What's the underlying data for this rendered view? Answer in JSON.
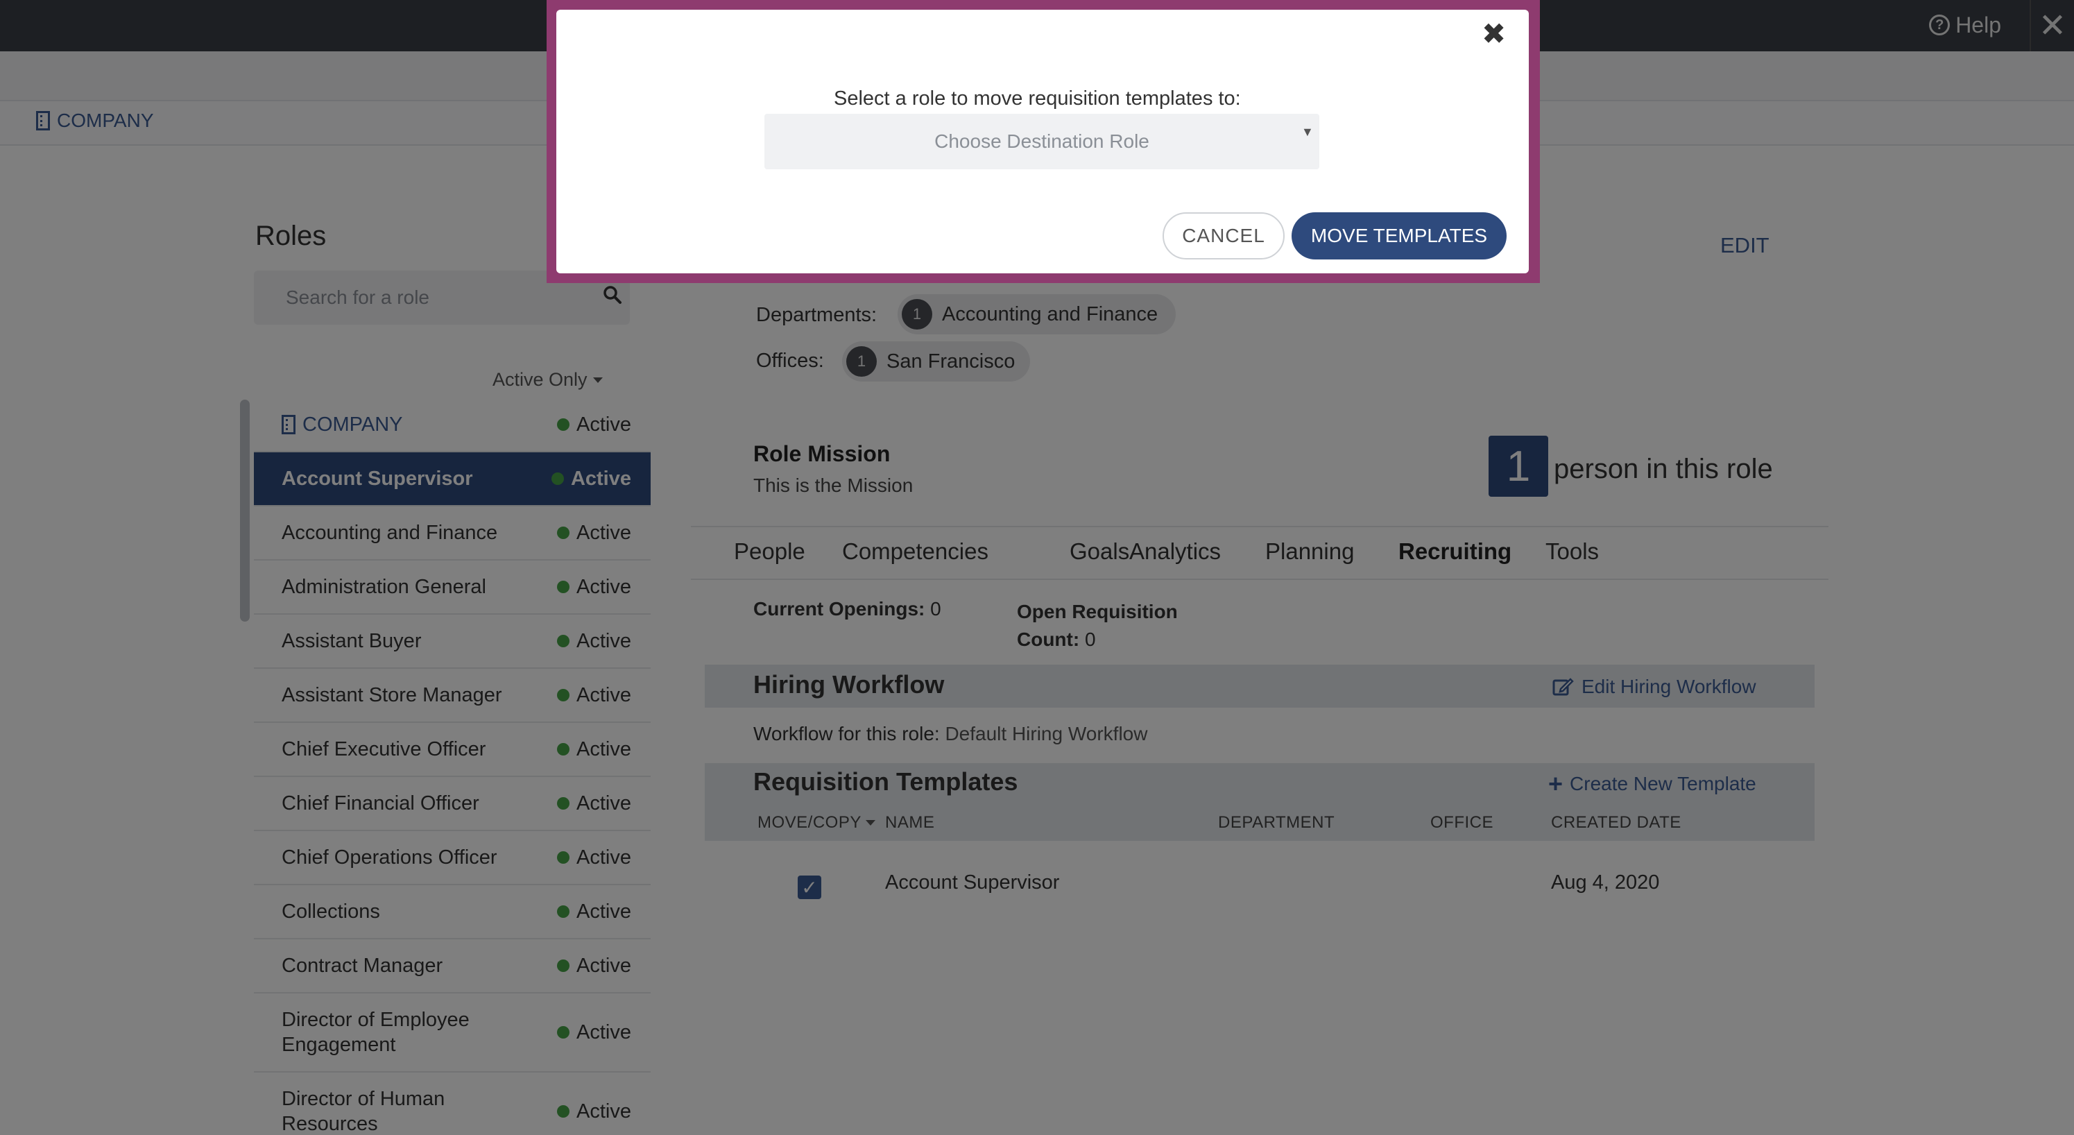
{
  "topbar": {
    "help_label": "Help",
    "help_icon": "question-circle-icon",
    "close_icon": "close-icon"
  },
  "breadcrumb": {
    "label": "COMPANY",
    "icon": "building-icon"
  },
  "roles": {
    "title": "Roles",
    "search_placeholder": "Search for a role",
    "filter_label": "Active Only",
    "items": [
      {
        "name": "COMPANY",
        "status": "Active"
      },
      {
        "name": "Account Supervisor",
        "status": "Active"
      },
      {
        "name": "Accounting and Finance",
        "status": "Active"
      },
      {
        "name": "Administration General",
        "status": "Active"
      },
      {
        "name": "Assistant Buyer",
        "status": "Active"
      },
      {
        "name": "Assistant Store Manager",
        "status": "Active"
      },
      {
        "name": "Chief Executive Officer",
        "status": "Active"
      },
      {
        "name": "Chief Financial Officer",
        "status": "Active"
      },
      {
        "name": "Chief Operations Officer",
        "status": "Active"
      },
      {
        "name": "Collections",
        "status": "Active"
      },
      {
        "name": "Contract Manager",
        "status": "Active"
      },
      {
        "name": "Director of Employee Engagement",
        "status": "Active"
      },
      {
        "name": "Director of Human Resources",
        "status": "Active"
      }
    ]
  },
  "role_detail": {
    "edit_label": "EDIT",
    "departments_label": "Departments:",
    "department_count": "1",
    "department": "Accounting and Finance",
    "offices_label": "Offices:",
    "office_count": "1",
    "office": "San Francisco",
    "mission_title": "Role Mission",
    "mission_text": "This is the Mission",
    "people_count": "1",
    "people_text": "person in this role",
    "tabs": [
      "People",
      "Competencies",
      "Goals",
      "Analytics",
      "Planning",
      "Recruiting",
      "Tools"
    ],
    "active_tab": "Recruiting"
  },
  "recruiting": {
    "openings_label": "Current Openings:",
    "openings_value": "0",
    "openreq_label_1": "Open Requisition",
    "openreq_label_2": "Count:",
    "openreq_value": "0",
    "hiring_workflow_title": "Hiring Workflow",
    "edit_workflow_label": "Edit Hiring Workflow",
    "workflow_label": "Workflow for this role:",
    "workflow_value": "Default Hiring Workflow",
    "templates_title": "Requisition Templates",
    "create_template_label": "Create New Template",
    "columns": [
      "MOVE/COPY",
      "NAME",
      "DEPARTMENT",
      "OFFICE",
      "CREATED DATE"
    ],
    "rows": [
      {
        "checked": true,
        "name": "Account Supervisor",
        "department": "",
        "office": "",
        "created": "Aug 4, 2020"
      }
    ]
  },
  "modal": {
    "prompt": "Select a role to move requisition templates to:",
    "select_placeholder": "Choose Destination Role",
    "cancel_label": "CANCEL",
    "move_label": "MOVE TEMPLATES",
    "close_icon": "close-icon"
  },
  "colors": {
    "brand": "#2e4a7d",
    "link": "#3b5a92",
    "active_dot": "#47a347",
    "modal_frame": "#8e3b6f",
    "topbar": "#3a3f47"
  }
}
